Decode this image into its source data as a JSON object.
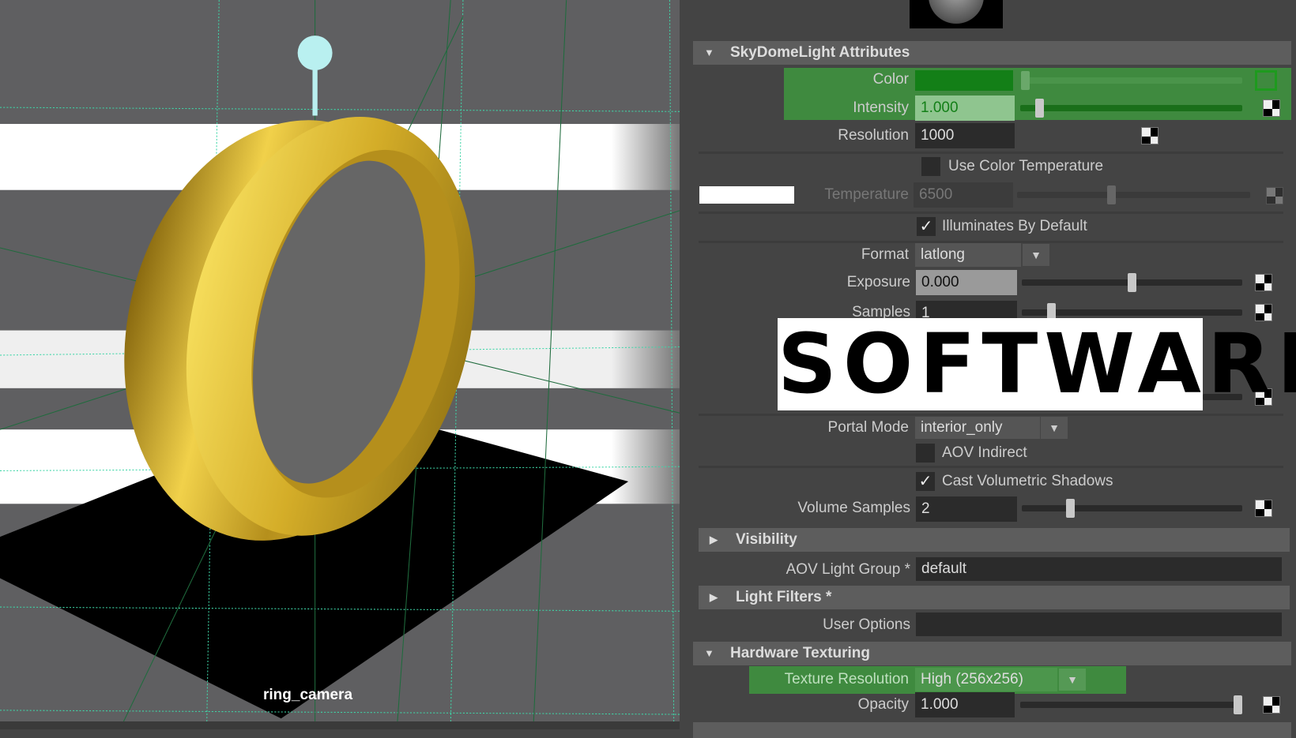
{
  "viewport": {
    "camera_label": "ring_camera",
    "colors": {
      "ring": "#d9b52a",
      "light": "#b9f0f0",
      "grid": "#3fd6a8",
      "plane": "#000000"
    }
  },
  "overlay": {
    "text": "SOFTWARE"
  },
  "panel": {
    "sections": {
      "skydome": "SkyDomeLight Attributes",
      "visibility": "Visibility",
      "light_filters": "Light Filters *",
      "hardware": "Hardware Texturing"
    },
    "color": {
      "label": "Color",
      "swatch": "#137f17"
    },
    "intensity": {
      "label": "Intensity",
      "value": "1.000",
      "slider": 0.07
    },
    "resolution": {
      "label": "Resolution",
      "value": "1000"
    },
    "use_color_temp": {
      "label": "Use Color Temperature",
      "checked": false
    },
    "temperature": {
      "label": "Temperature",
      "value": "6500",
      "slider": 0.4
    },
    "illuminates": {
      "label": "Illuminates By Default",
      "checked": true
    },
    "format": {
      "label": "Format",
      "value": "latlong"
    },
    "exposure": {
      "label": "Exposure",
      "value": "0.000",
      "slider": 0.5
    },
    "samples": {
      "label": "Samples",
      "value": "1",
      "slider": 0.12
    },
    "portal_mode": {
      "label": "Portal Mode",
      "value": "interior_only"
    },
    "aov_indirect": {
      "label": "AOV Indirect",
      "checked": false
    },
    "cast_vol": {
      "label": "Cast Volumetric Shadows",
      "checked": true
    },
    "volume_samples": {
      "label": "Volume Samples",
      "value": "2",
      "slider": 0.21
    },
    "aov_light_group": {
      "label": "AOV Light Group *",
      "value": "default"
    },
    "user_options": {
      "label": "User Options",
      "value": ""
    },
    "texture_resolution": {
      "label": "Texture Resolution",
      "value": "High (256x256)"
    },
    "opacity": {
      "label": "Opacity",
      "value": "1.000",
      "slider": 1.0
    },
    "highlight_color": "#3f8a3f",
    "check_mark": "✓",
    "tri_down": "▼",
    "tri_right": "▶",
    "dd": "▼"
  }
}
